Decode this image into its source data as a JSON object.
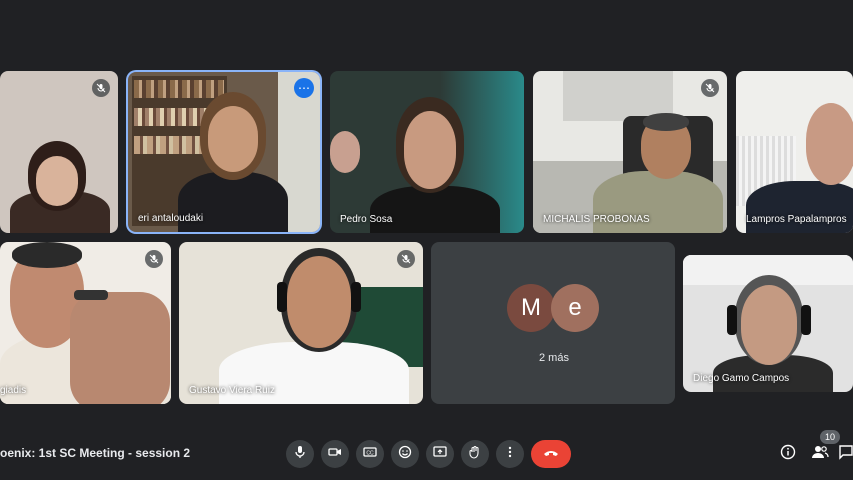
{
  "participants": [
    {
      "name": "",
      "muted": true
    },
    {
      "name": "eri antaloudaki",
      "muted": false,
      "active": true
    },
    {
      "name": "Pedro Sosa",
      "muted": false
    },
    {
      "name": "MICHALIS PROBONAS",
      "muted": true
    },
    {
      "name": "Lampros Papalampros",
      "muted": false
    },
    {
      "name": "giadis",
      "muted": true
    },
    {
      "name": "Gustavo Viera Ruiz",
      "muted": true
    },
    {
      "name": "Diego Gamo Campos",
      "muted": false
    }
  ],
  "others_tile": {
    "avatar1": "M",
    "avatar2": "e",
    "label": "2 más"
  },
  "meeting": {
    "title": "oenix: 1st SC Meeting - session 2"
  },
  "people_count": "10",
  "icons": {
    "mic": "microphone-icon",
    "camera": "camera-icon",
    "captions": "captions-icon",
    "emoji": "emoji-icon",
    "present": "present-screen-icon",
    "raise_hand": "raise-hand-icon",
    "more": "more-options-icon",
    "end_call": "end-call-icon",
    "info": "info-icon",
    "people": "people-icon",
    "chat": "chat-icon"
  },
  "colors": {
    "background": "#202124",
    "tile": "#3c4043",
    "end_call": "#ea4335",
    "active_border": "#8ab4f8",
    "avatar_m": "#7a4a3f",
    "avatar_e": "#a0705f"
  }
}
